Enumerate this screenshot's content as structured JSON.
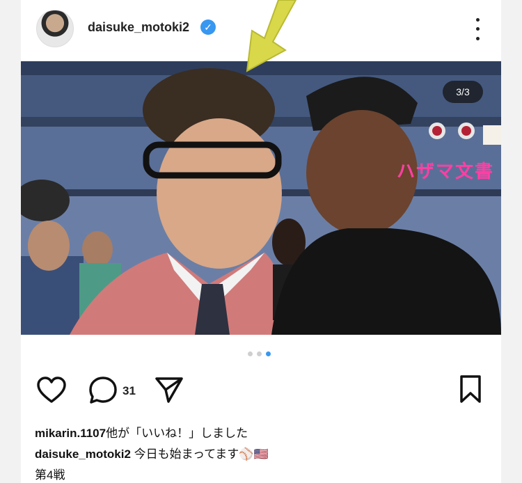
{
  "post": {
    "username": "daisuke_motoki2",
    "verified": true,
    "image_counter": "3/3",
    "overlay_text": "ハザマ文書",
    "carousel": {
      "total": 3,
      "active_index": 3
    },
    "comment_count": "31",
    "likes_user": "mikarin.1107",
    "likes_suffix": "他が「いいね！」しました",
    "caption_user": "daisuke_motoki2",
    "caption_text": " 今日も始まってます⚾🇺🇸",
    "time_label": "第4戦"
  },
  "icons": {
    "verified": "verified-badge-icon",
    "more": "more-vertical-icon",
    "like": "heart-icon",
    "comment": "comment-icon",
    "share": "paper-plane-icon",
    "save": "bookmark-icon"
  },
  "colors": {
    "accent": "#3897f0",
    "overlay_text": "#ff3fa4",
    "arrow": "#d8d84a"
  }
}
